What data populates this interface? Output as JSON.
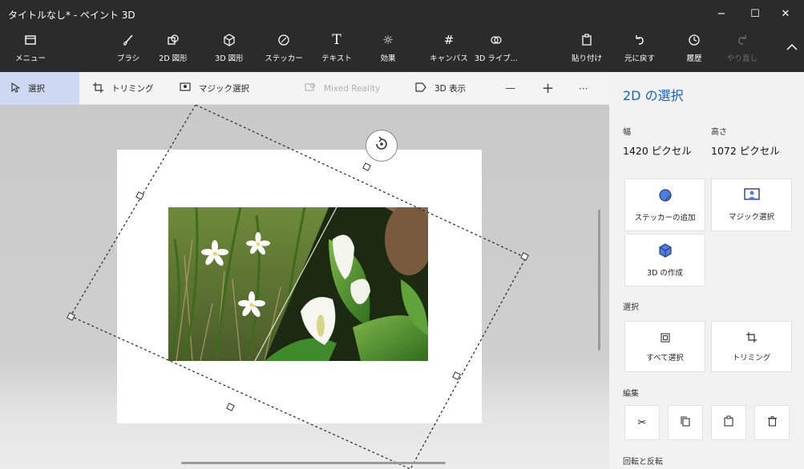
{
  "window": {
    "title": "タイトルなし* - ペイント 3D",
    "controls": {
      "minimize": "−",
      "maximize": "☐",
      "close": "✕"
    }
  },
  "toolbar": {
    "items": [
      {
        "label": "メニュー",
        "icon": "folder-icon"
      },
      {
        "label": "ブラシ",
        "icon": "brush-icon"
      },
      {
        "label": "2D 図形",
        "icon": "2d-shapes-icon"
      },
      {
        "label": "3D 図形",
        "icon": "3d-shapes-icon"
      },
      {
        "label": "ステッカー",
        "icon": "sticker-icon"
      },
      {
        "label": "テキスト",
        "icon": "text-icon"
      },
      {
        "label": "効果",
        "icon": "effects-icon"
      },
      {
        "label": "キャンバス",
        "icon": "canvas-icon"
      },
      {
        "label": "3D ライブ...",
        "icon": "3d-library-icon"
      },
      {
        "label": "貼り付け",
        "icon": "paste-icon"
      },
      {
        "label": "元に戻す",
        "icon": "undo-icon"
      },
      {
        "label": "履歴",
        "icon": "history-icon"
      },
      {
        "label": "やり直し",
        "icon": "redo-icon",
        "disabled": true
      }
    ]
  },
  "subtoolbar": {
    "select": "選択",
    "crop": "トリミング",
    "magic_select": "マジック選択",
    "mixed_reality": "Mixed Reality",
    "view_3d": "3D 表示",
    "zoom_out": "—",
    "zoom_in": "+",
    "more": "···"
  },
  "panel": {
    "title": "2D の選択",
    "width_label": "幅",
    "height_label": "高さ",
    "width_value": "1420 ピクセル",
    "height_value": "1072 ピクセル",
    "add_sticker": "ステッカーの追加",
    "magic_select": "マジック選択",
    "make_3d": "3D の作成",
    "select_section": "選択",
    "select_all": "すべて選択",
    "crop": "トリミング",
    "edit_section": "編集",
    "rotate_section": "回転と反転"
  },
  "colors": {
    "accent": "#1d5fc8",
    "dark_chrome": "#2b2b2b",
    "selected_tool": "#cfd8f3"
  }
}
